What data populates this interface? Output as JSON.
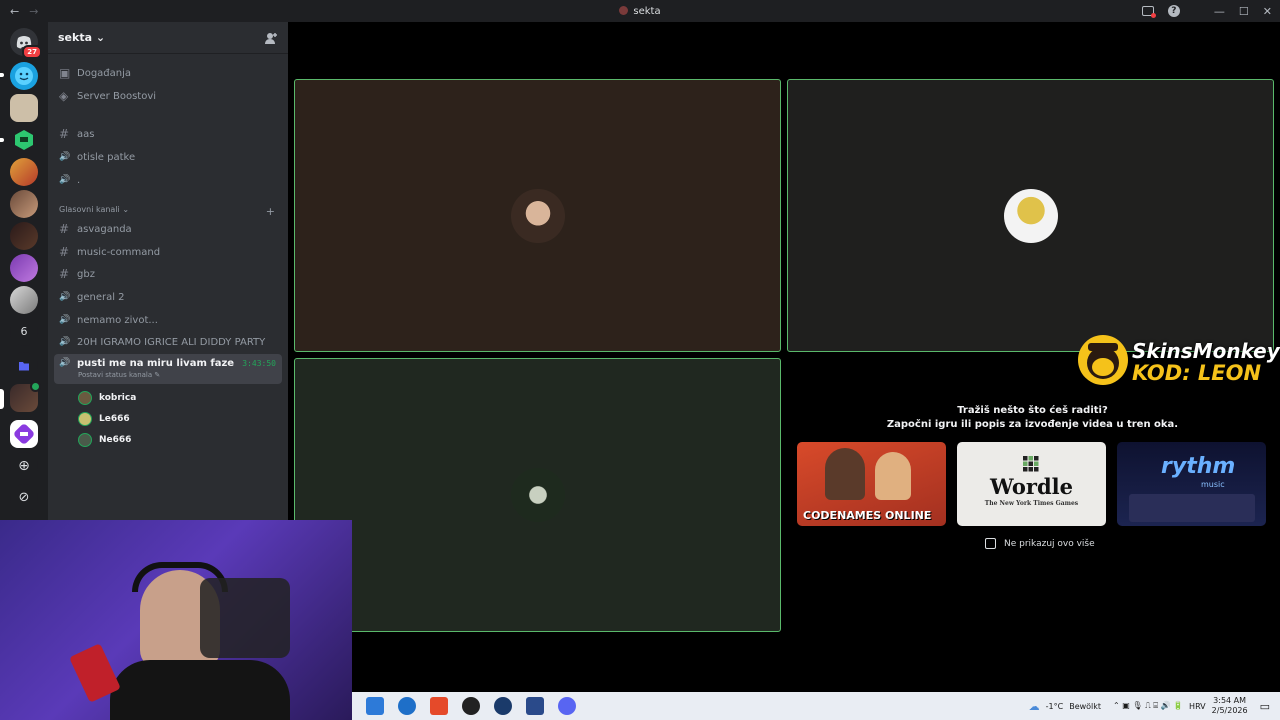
{
  "window": {
    "title": "sekta",
    "back_glyph": "←",
    "forward_glyph": "→",
    "minimize_glyph": "—",
    "maximize_glyph": "☐",
    "close_glyph": "✕",
    "help_glyph": "?"
  },
  "guilds": {
    "dm_badge": "27",
    "folder_count": "6"
  },
  "server": {
    "name": "sekta",
    "chevron": "⌄"
  },
  "sidebar": {
    "top_items": [
      {
        "icon": "calendar-icon",
        "glyph": "▣",
        "label": "Događanja"
      },
      {
        "icon": "boost-icon",
        "glyph": "◈",
        "label": "Server Boostovi"
      }
    ],
    "text_channels": [
      {
        "glyph": "#",
        "label": "aas"
      },
      {
        "glyph": "🔊",
        "label": "otisle patke"
      },
      {
        "glyph": "🔊",
        "label": "."
      }
    ],
    "voice_category": "Glasovni kanali",
    "voice_category_add": "+",
    "voice_channels": [
      {
        "glyph": "#",
        "label": "asvaganda"
      },
      {
        "glyph": "#",
        "label": "music-command"
      },
      {
        "glyph": "#",
        "label": "gbz"
      },
      {
        "glyph": "🔊",
        "label": "general 2"
      },
      {
        "glyph": "🔊",
        "label": "nemamo zivot..."
      },
      {
        "glyph": "🔊",
        "label": "20H IGRAMO IGRICE ALI DIDDY PARTY"
      }
    ],
    "active_channel": {
      "label": "pusti me na miru livam faze",
      "timer": "3:43:50",
      "status": "Postavi status kanala ✎"
    },
    "voice_users": [
      "kobrica",
      "Le666",
      "Ne666"
    ]
  },
  "activity": {
    "line1": "Tražiš nešto što ćeš raditi?",
    "line2": "Započni igru ili popis za izvođenje videa u tren oka.",
    "cards": [
      {
        "label": "CODENAMES ONLINE",
        "bg": "#c6432b"
      },
      {
        "label": "Wordle",
        "sub": "The New York Times Games",
        "bg": "#ecebe8"
      },
      {
        "label": "rythm",
        "sub": "music",
        "bg": "#141a3a"
      }
    ],
    "checkbox_label": "Ne prikazuj ovo više"
  },
  "sponsor": {
    "line1": "SkinsMonkey",
    "line2": "KOD: LEON"
  },
  "taskbar": {
    "weather_temp": "-1°C",
    "weather_text": "Bewölkt",
    "lang": "HRV",
    "time": "3:54 AM",
    "date": "2/5/2026",
    "tray_glyphs": "⌃  ▣  🎙  ⎍  ⌸  🔊  🔋"
  },
  "colors": {
    "tile_border": "#5ab96b",
    "speaking": "#23a55a",
    "tile1_bg": "#2d221b",
    "tile2_bg": "#1f1f1e",
    "tile3_bg": "#202820"
  }
}
